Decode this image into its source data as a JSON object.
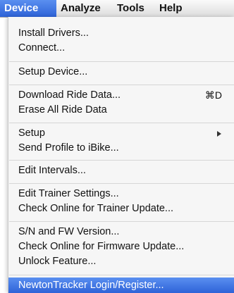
{
  "menubar": {
    "items": [
      {
        "label": "Device",
        "active": true
      },
      {
        "label": "Analyze",
        "active": false
      },
      {
        "label": "Tools",
        "active": false
      },
      {
        "label": "Help",
        "active": false
      }
    ]
  },
  "device_menu": {
    "groups": [
      [
        {
          "label": "Install Drivers..."
        },
        {
          "label": "Connect..."
        }
      ],
      [
        {
          "label": "Setup Device..."
        }
      ],
      [
        {
          "label": "Download Ride Data...",
          "shortcut": "⌘D"
        },
        {
          "label": "Erase All Ride Data"
        }
      ],
      [
        {
          "label": "Setup",
          "submenu_icon": "chevron-right-icon"
        },
        {
          "label": "Send Profile to iBike..."
        }
      ],
      [
        {
          "label": "Edit Intervals..."
        }
      ],
      [
        {
          "label": "Edit Trainer Settings..."
        },
        {
          "label": "Check Online for Trainer Update..."
        }
      ],
      [
        {
          "label": "S/N and FW Version..."
        },
        {
          "label": "Check Online for Firmware Update..."
        },
        {
          "label": "Unlock Feature..."
        }
      ],
      [
        {
          "label": "NewtonTracker Login/Register...",
          "highlighted": true
        }
      ]
    ]
  },
  "colors": {
    "highlight": "#2e63d8",
    "menu_background": "#f6f6f6",
    "separator": "#d6d6d6"
  }
}
